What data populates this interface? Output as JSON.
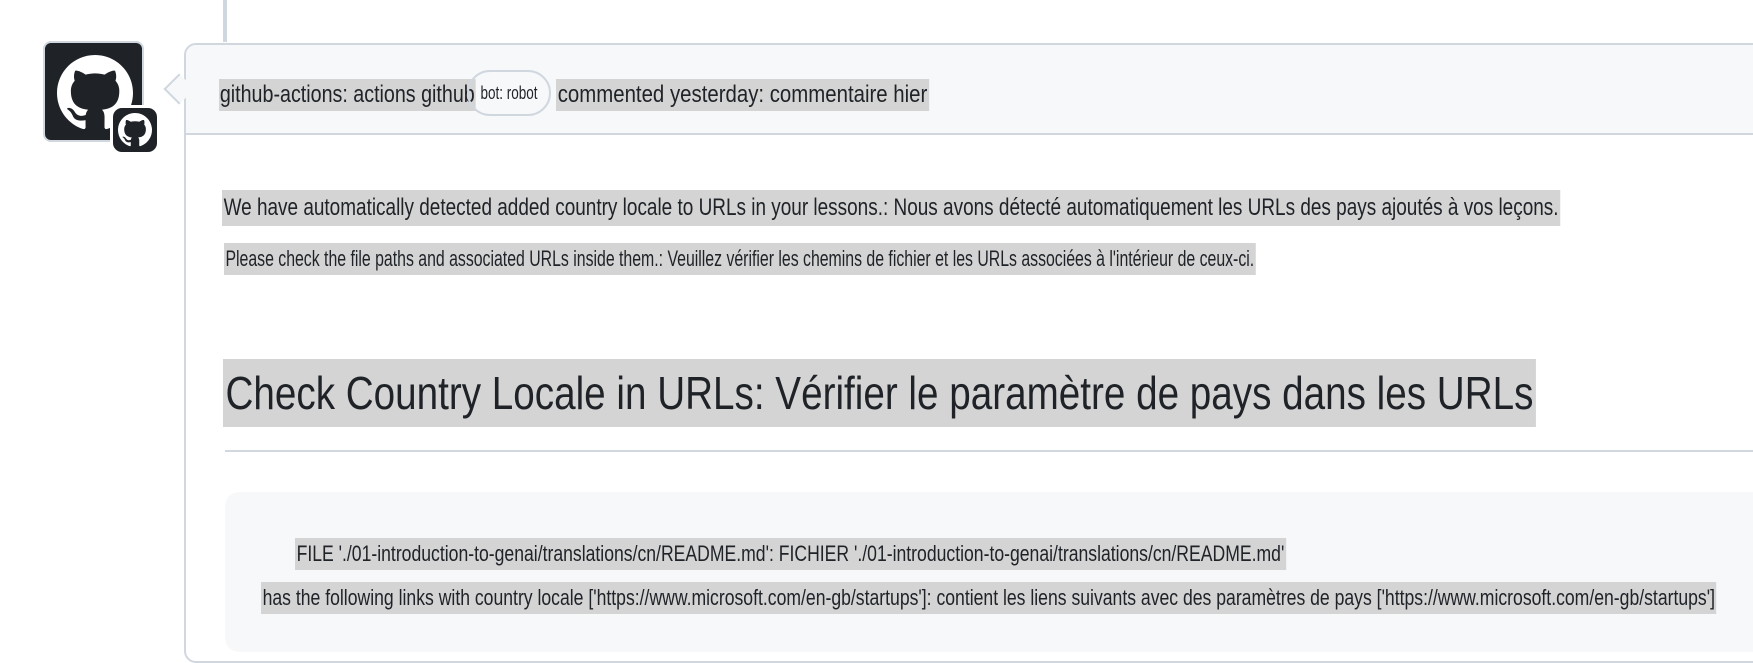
{
  "comment": {
    "author": "github-actions: actions github",
    "bot_label": "bot: robot",
    "timestamp": "commented yesterday: commentaire hier",
    "body": {
      "line1": "We have automatically detected added country locale to URLs in your lessons.: Nous avons détecté automatiquement les URLs des pays ajoutés à vos leçons.",
      "line2": "Please check the file paths and associated URLs inside them.: Veuillez vérifier les chemins de fichier et les URLs associées à l'intérieur de ceux-ci."
    },
    "heading": "Check Country Locale in URLs: Vérifier le paramètre de pays dans les URLs",
    "code": {
      "line1": "FILE './01-introduction-to-genai/translations/cn/README.md': FICHIER './01-introduction-to-genai/translations/cn/README.md'",
      "line2": "has the following links with country locale ['https://www.microsoft.com/en-gb/startups']: contient les liens suivants avec des paramètres de pays ['https://www.microsoft.com/en-gb/startups']"
    }
  },
  "icons": {
    "avatar": "github-octocat-icon",
    "badge": "github-app-badge-icon"
  },
  "colors": {
    "border": "#d0d7de",
    "header_bg": "#f6f8fa",
    "text": "#1f2328",
    "highlight": "#d4d4d4"
  }
}
